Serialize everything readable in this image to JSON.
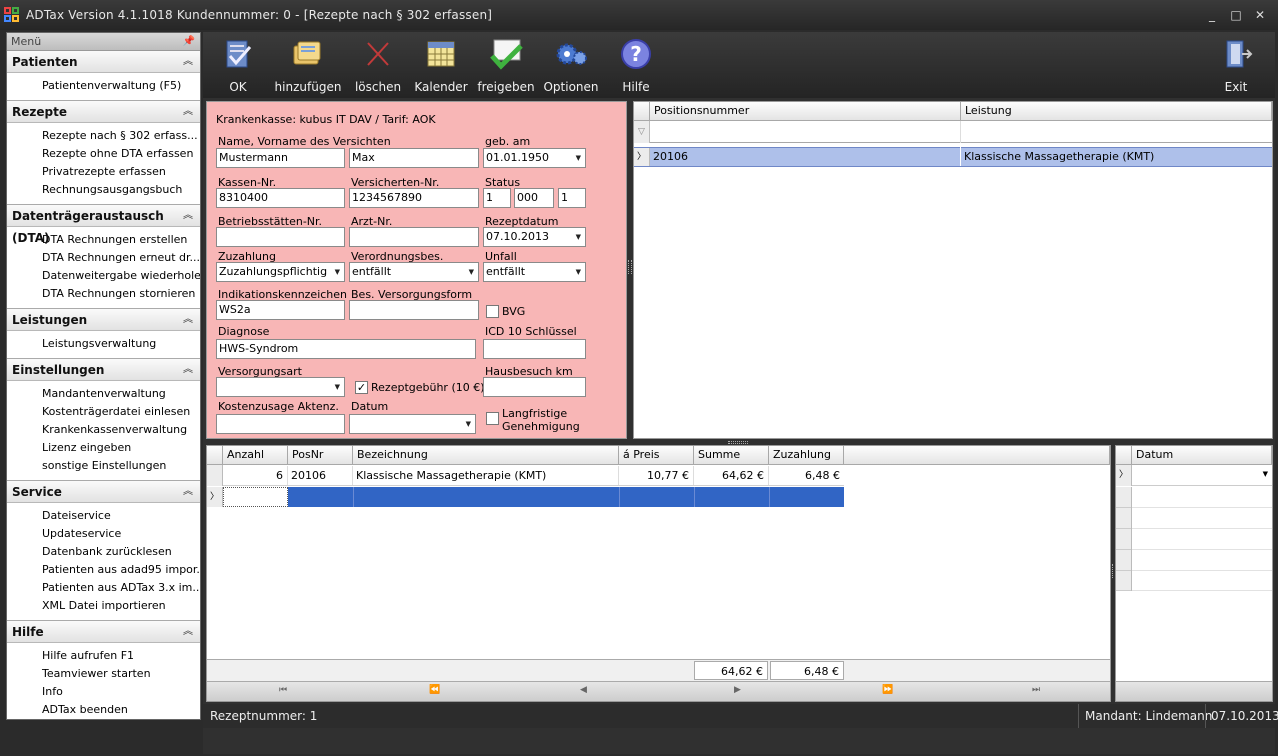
{
  "window": {
    "title": "ADTax  Version 4.1.1018  Kundennummer: 0 - [Rezepte nach § 302 erfassen]",
    "controls": [
      "_",
      "□",
      "✕"
    ]
  },
  "sidebar": {
    "header": "Menü",
    "groups": [
      {
        "title": "Patienten",
        "items": [
          "Patientenverwaltung (F5)"
        ]
      },
      {
        "title": "Rezepte",
        "items": [
          "Rezepte nach § 302 erfass...",
          "Rezepte ohne DTA erfassen",
          "Privatrezepte erfassen",
          "Rechnungsausgangsbuch"
        ]
      },
      {
        "title": "Datenträgeraustausch (DTA)",
        "items": [
          "DTA Rechnungen erstellen",
          "DTA Rechnungen erneut dr...",
          "Datenweitergabe wiederholen",
          "DTA Rechnungen stornieren"
        ]
      },
      {
        "title": "Leistungen",
        "items": [
          "Leistungsverwaltung"
        ]
      },
      {
        "title": "Einstellungen",
        "items": [
          "Mandantenverwaltung",
          "Kostenträgerdatei einlesen",
          "Krankenkassenverwaltung",
          "Lizenz eingeben",
          "sonstige Einstellungen"
        ]
      },
      {
        "title": "Service",
        "items": [
          "Dateiservice",
          "Updateservice",
          "Datenbank zurücklesen",
          "Patienten aus adad95 impor...",
          "Patienten aus ADTax 3.x im...",
          "XML Datei  importieren"
        ]
      },
      {
        "title": "Hilfe",
        "items": [
          "Hilfe aufrufen F1",
          "Teamviewer starten",
          "Info",
          "ADTax beenden"
        ]
      }
    ]
  },
  "toolbar": {
    "ok": "OK",
    "add": "hinzufügen",
    "delete": "löschen",
    "calendar": "Kalender",
    "release": "freigeben",
    "options": "Optionen",
    "help": "Hilfe",
    "exit": "Exit"
  },
  "form": {
    "kasse_line": "Krankenkasse: kubus IT DAV / Tarif: AOK",
    "name_label": "Name, Vorname des Versichten",
    "lastname": "Mustermann",
    "firstname": "Max",
    "dob_label": "geb. am",
    "dob": "01.01.1950",
    "kassen_nr_label": "Kassen-Nr.",
    "kassen_nr": "8310400",
    "versicherten_nr_label": "Versicherten-Nr.",
    "versicherten_nr": "1234567890",
    "status_label": "Status",
    "status1": "1",
    "status2": "000",
    "status3": "1",
    "betriebsstaetten_label": "Betriebsstätten-Nr.",
    "betriebsstaetten": "",
    "arzt_label": "Arzt-Nr.",
    "arzt": "",
    "rezeptdatum_label": "Rezeptdatum",
    "rezeptdatum": "07.10.2013",
    "zuzahlung_label": "Zuzahlung",
    "zuzahlung": "Zuzahlungspflichtig",
    "verordnung_label": "Verordnungsbes.",
    "verordnung": "entfällt",
    "unfall_label": "Unfall",
    "unfall": "entfällt",
    "indikation_label": "Indikationskennzeichen",
    "indikation": "WS2a",
    "versorgungsform_label": "Bes. Versorgungsform",
    "versorgungsform": "",
    "bvg_label": "BVG",
    "diagnose_label": "Diagnose",
    "diagnose": "HWS-Syndrom",
    "icd_label": "ICD 10 Schlüssel",
    "icd": "",
    "versorgungsart_label": "Versorgungsart",
    "versorgungsart": "",
    "rezeptgebuehr_label": "Rezeptgebühr (10 €)",
    "rezeptgebuehr_checked": "✓",
    "hausbesuch_label": "Hausbesuch km",
    "hausbesuch": "",
    "kostenzusage_label": "Kostenzusage Aktenz.",
    "kostenzusage": "",
    "datum_label": "Datum",
    "datum": "",
    "langfristig_label1": "Langfristige",
    "langfristig_label2": "Genehmigung"
  },
  "positions_grid": {
    "columns": [
      "Positionsnummer",
      "Leistung"
    ],
    "rows": [
      {
        "posnr": "20106",
        "leistung": "Klassische Massagetherapie (KMT)"
      }
    ]
  },
  "items_grid": {
    "columns": [
      "Anzahl",
      "PosNr",
      "Bezeichnung",
      "á Preis",
      "Summe",
      "Zuzahlung"
    ],
    "rows": [
      {
        "anzahl": "6",
        "posnr": "20106",
        "bezeichnung": "Klassische Massagetherapie (KMT)",
        "preis": "10,77 €",
        "summe": "64,62 €",
        "zuzahlung": "6,48 €"
      }
    ],
    "total_summe": "64,62 €",
    "total_zuzahlung": "6,48 €"
  },
  "date_grid": {
    "columns": [
      "Datum"
    ]
  },
  "statusbar": {
    "rezeptnummer": "Rezeptnummer: 1",
    "mandant": "Mandant: Lindemann",
    "date": "07.10.2013"
  },
  "colors": {
    "form_bg": "#f8b6b6",
    "selection_blue": "#3165c5",
    "selection_light": "#aec0ea",
    "toolbar_bg": "#2b2b2b"
  }
}
